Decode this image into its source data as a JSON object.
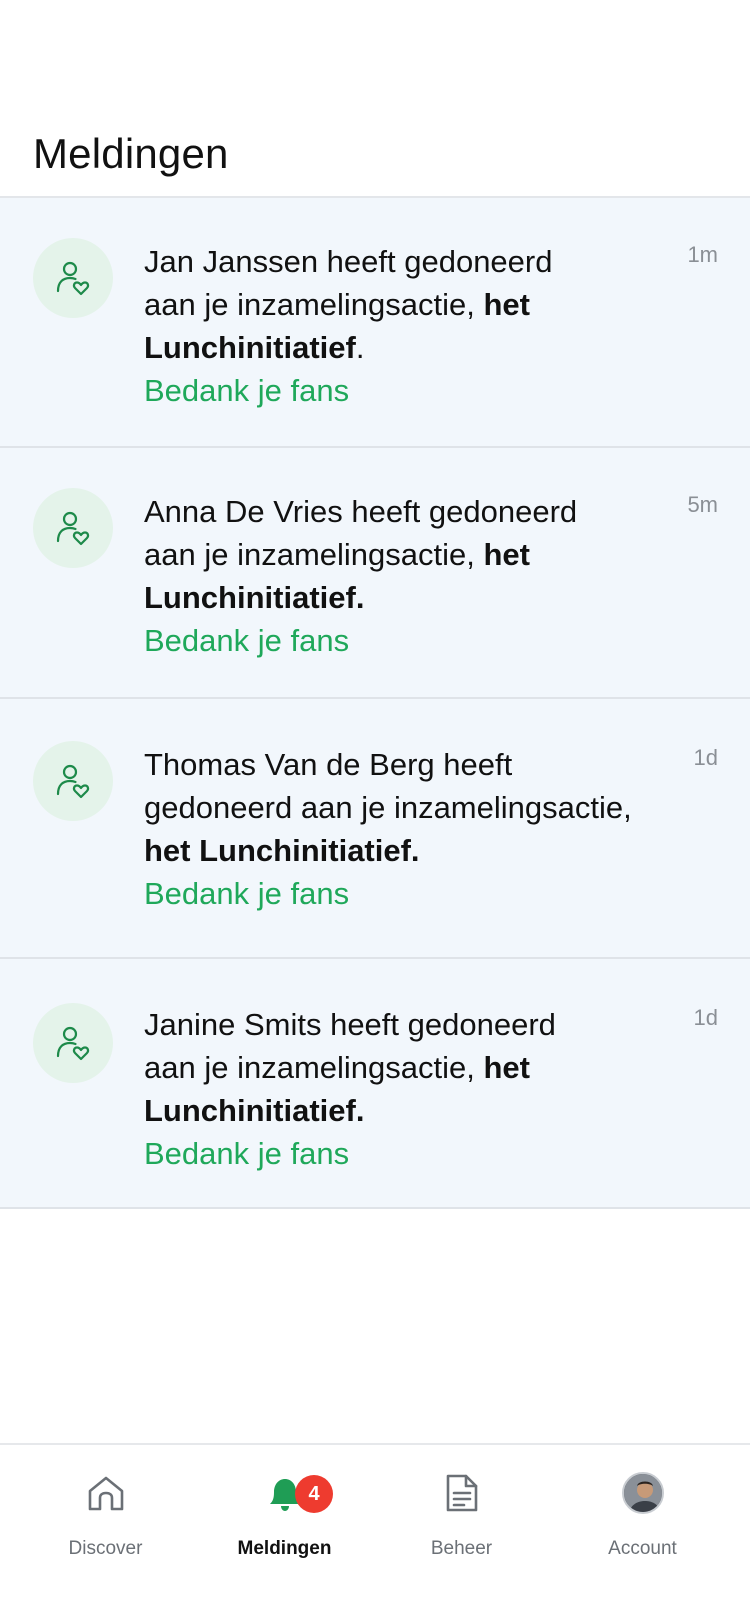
{
  "header": {
    "title": "Meldingen"
  },
  "notifications": [
    {
      "name": "Jan Janssen",
      "line1": "Jan Janssen heeft gedoneerd",
      "line2": "aan je inzamelingsactie, ",
      "bold2": "het",
      "line3_bold": "Lunchinitiatief",
      "line3_rest": ".",
      "action": "Bedank je fans",
      "time": "1m"
    },
    {
      "name": "Anna De Vries",
      "line1": "Anna De Vries heeft gedoneerd",
      "line2": "aan je inzamelingsactie, ",
      "bold2": "het",
      "line3_bold": "Lunchinitiatief.",
      "line3_rest": "",
      "action": "Bedank je fans",
      "time": "5m"
    },
    {
      "name": "Thomas Van de Berg",
      "line1": "Thomas Van de Berg heeft",
      "line2": "gedoneerd aan je inzamelingsactie,",
      "bold2": "",
      "line3_bold": "het Lunchinitiatief.",
      "line3_rest": "",
      "action": "Bedank je fans",
      "time": "1d"
    },
    {
      "name": "Janine Smits",
      "line1": "Janine Smits heeft gedoneerd",
      "line2": "aan je inzamelingsactie, ",
      "bold2": "het",
      "line3_bold": "Lunchinitiatief.",
      "line3_rest": "",
      "action": "Bedank je fans",
      "time": "1d"
    }
  ],
  "tabbar": {
    "items": [
      {
        "label": "Discover",
        "icon": "home-icon"
      },
      {
        "label": "Meldingen",
        "icon": "bell-icon",
        "badge": "4"
      },
      {
        "label": "Beheer",
        "icon": "document-icon"
      },
      {
        "label": "Account",
        "icon": "avatar"
      }
    ]
  },
  "colors": {
    "accent_green": "#1fa85a",
    "badge_red": "#ee3b2f",
    "item_bg": "#f2f7fc"
  }
}
